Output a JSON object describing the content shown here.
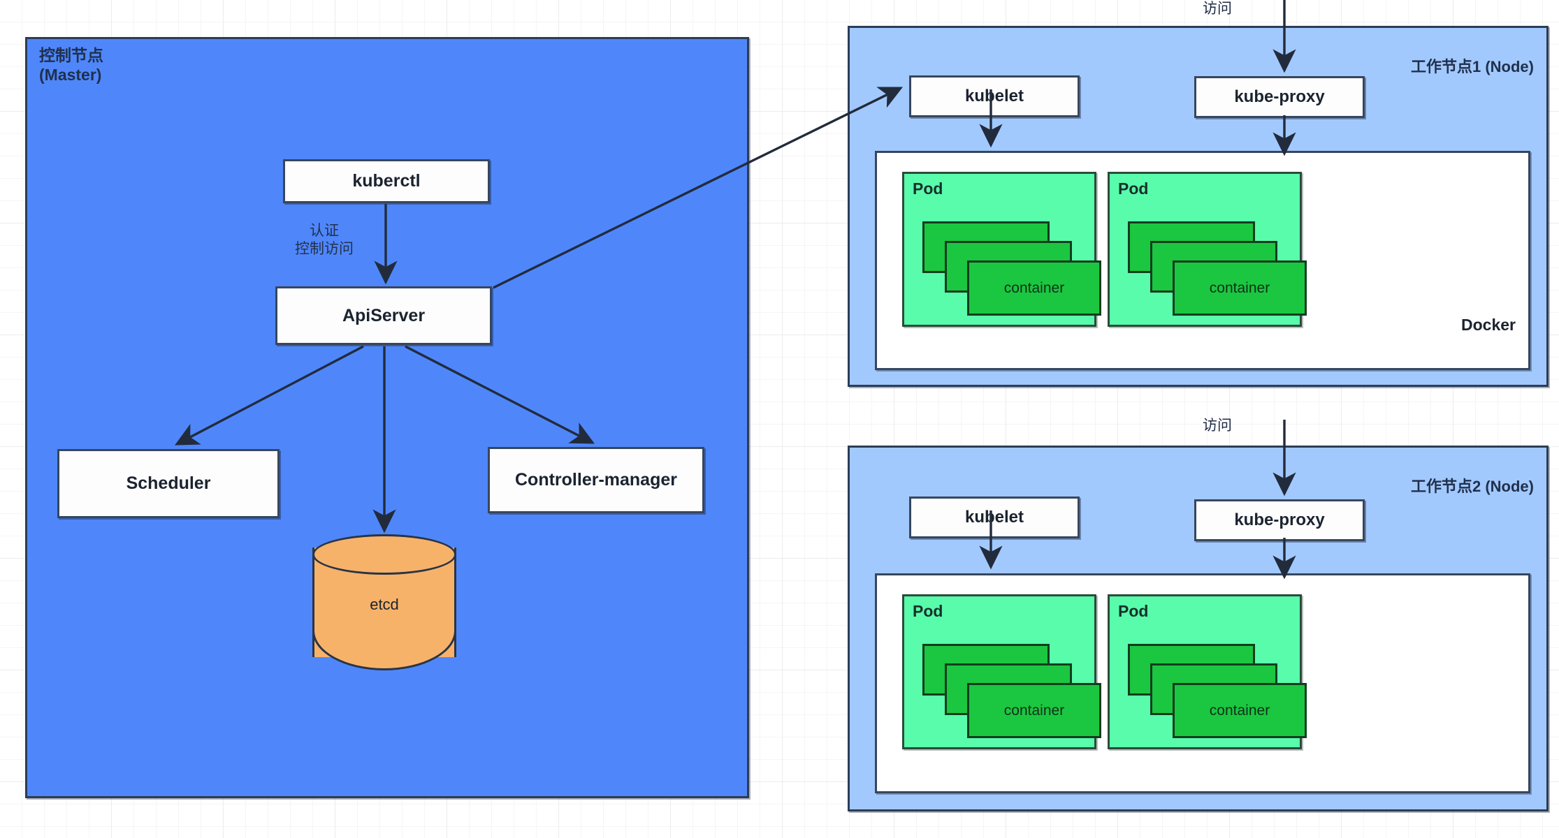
{
  "diagram": {
    "title": "Kubernetes Cluster Architecture",
    "colors": {
      "master_fill": "#4f87fb",
      "worker_fill": "#a2c9fd",
      "pod_fill": "#59fcab",
      "container_fill": "#1bc740",
      "etcd_fill": "#f7b26a",
      "component_fill": "#fdfdfd",
      "stroke": "#2c3c55",
      "grid": "#ececec"
    }
  },
  "master": {
    "label": "控制节点\n(Master)",
    "components": {
      "kuberctl": "kuberctl",
      "apiserver": "ApiServer",
      "scheduler": "Scheduler",
      "controller_manager": "Controller-manager",
      "etcd": "etcd"
    },
    "edge_labels": {
      "kuberctl_to_apiserver": "认证\n控制访问"
    }
  },
  "workers": [
    {
      "title": "工作节点1\n(Node)",
      "access_label": "访问",
      "kubelet": "kubelet",
      "kube_proxy": "kube-proxy",
      "runtime": "Docker",
      "pods": [
        {
          "label": "Pod",
          "container": "container"
        },
        {
          "label": "Pod",
          "container": "container"
        }
      ]
    },
    {
      "title": "工作节点2\n(Node)",
      "access_label": "访问",
      "kubelet": "kubelet",
      "kube_proxy": "kube-proxy",
      "runtime": "",
      "pods": [
        {
          "label": "Pod",
          "container": "container"
        },
        {
          "label": "Pod",
          "container": "container"
        }
      ]
    }
  ]
}
